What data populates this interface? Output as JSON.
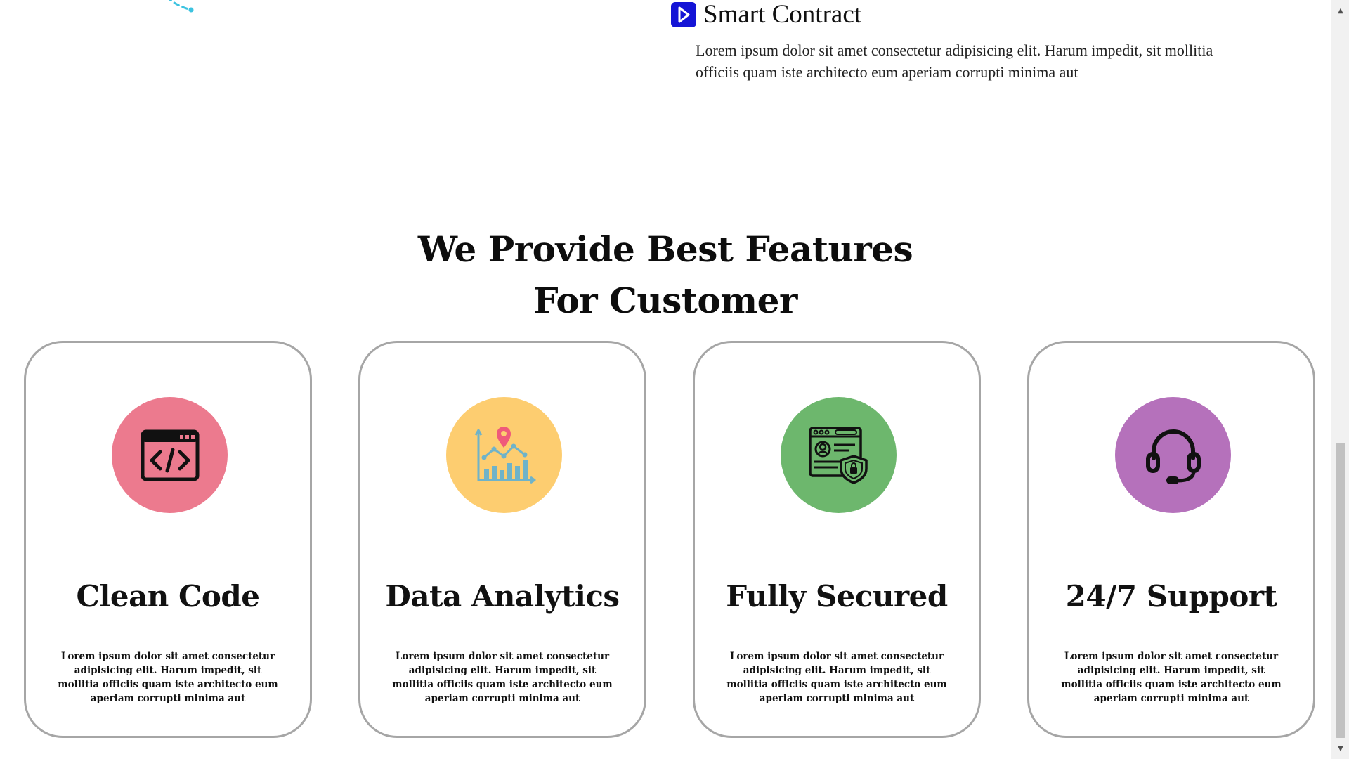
{
  "smart_contract": {
    "icon": "play-icon",
    "title": "Smart Contract",
    "text": "Lorem ipsum dolor sit amet consectetur adipisicing elit. Harum impedit, sit mollitia officiis quam iste architecto eum aperiam corrupti minima aut"
  },
  "features": {
    "title_line1": "We Provide Best Features",
    "title_line2": "For Customer",
    "cards": [
      {
        "icon": "code-window-icon",
        "circle_color": "#ec7a8e",
        "title": "Clean Code",
        "text": "Lorem ipsum dolor sit amet consectetur adipisicing elit. Harum impedit, sit mollitia officiis quam iste architecto eum aperiam corrupti minima aut"
      },
      {
        "icon": "analytics-chart-icon",
        "circle_color": "#fdcd70",
        "title": "Data Analytics",
        "text": "Lorem ipsum dolor sit amet consectetur adipisicing elit. Harum impedit, sit mollitia officiis quam iste architecto eum aperiam corrupti minima aut"
      },
      {
        "icon": "secure-profile-icon",
        "circle_color": "#6db76d",
        "title": "Fully Secured",
        "text": "Lorem ipsum dolor sit amet consectetur adipisicing elit. Harum impedit, sit mollitia officiis quam iste architecto eum aperiam corrupti minima aut"
      },
      {
        "icon": "headset-icon",
        "circle_color": "#b571bb",
        "title": "24/7 Support",
        "text": "Lorem ipsum dolor sit amet consectetur adipisicing elit. Harum impedit, sit mollitia officiis quam iste architecto eum aperiam corrupti minima aut"
      }
    ]
  },
  "colors": {
    "accent_blue": "#1414d6",
    "card_border": "#a6a6a6",
    "deco_cyan": "#3cc3e0"
  }
}
